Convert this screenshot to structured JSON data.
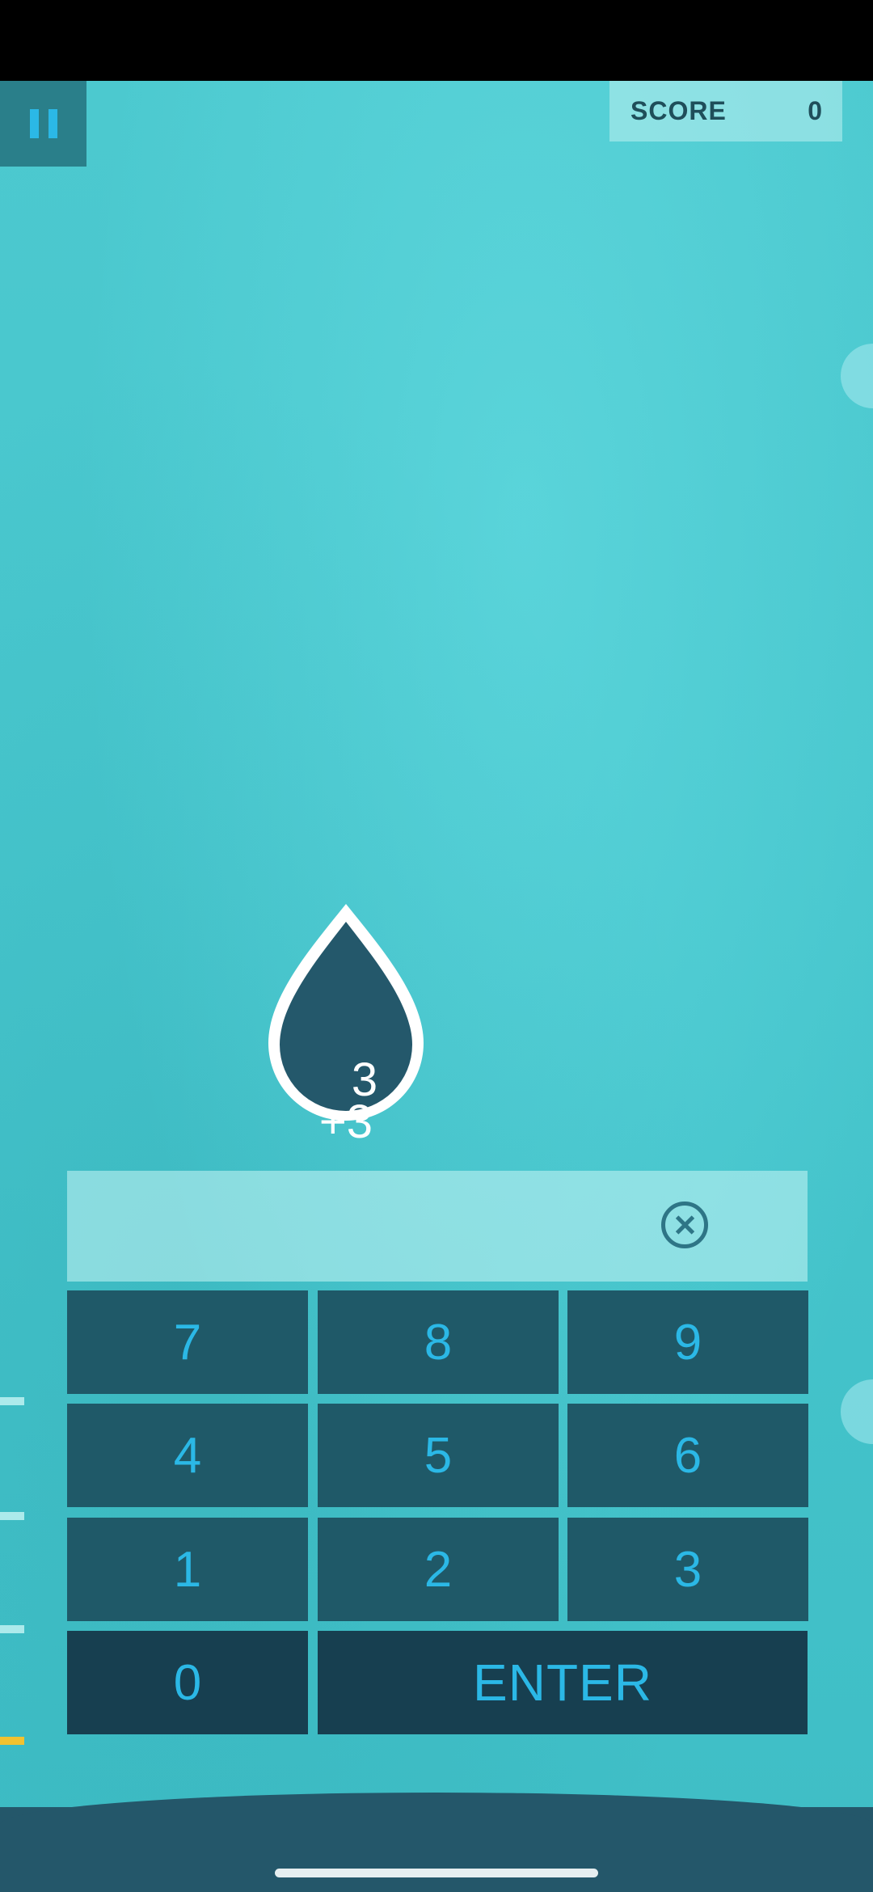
{
  "hud": {
    "pause_icon": "pause-icon",
    "score_label": "SCORE",
    "score_value": "0"
  },
  "drop": {
    "top_number": "3",
    "bottom_number": "+3",
    "fill_color": "#24586b",
    "outline_color": "#ffffff"
  },
  "answer": {
    "value": "",
    "clear_icon": "close-circle-icon"
  },
  "keypad": {
    "k7": "7",
    "k8": "8",
    "k9": "9",
    "k4": "4",
    "k5": "5",
    "k6": "6",
    "k1": "1",
    "k2": "2",
    "k3": "3",
    "k0": "0",
    "enter": "ENTER"
  },
  "colors": {
    "background": "#47c6cd",
    "key_fill": "#1f5968",
    "key_text": "#2bb8e6",
    "water": "#24576a",
    "level_marker_active": "#f2c230"
  }
}
